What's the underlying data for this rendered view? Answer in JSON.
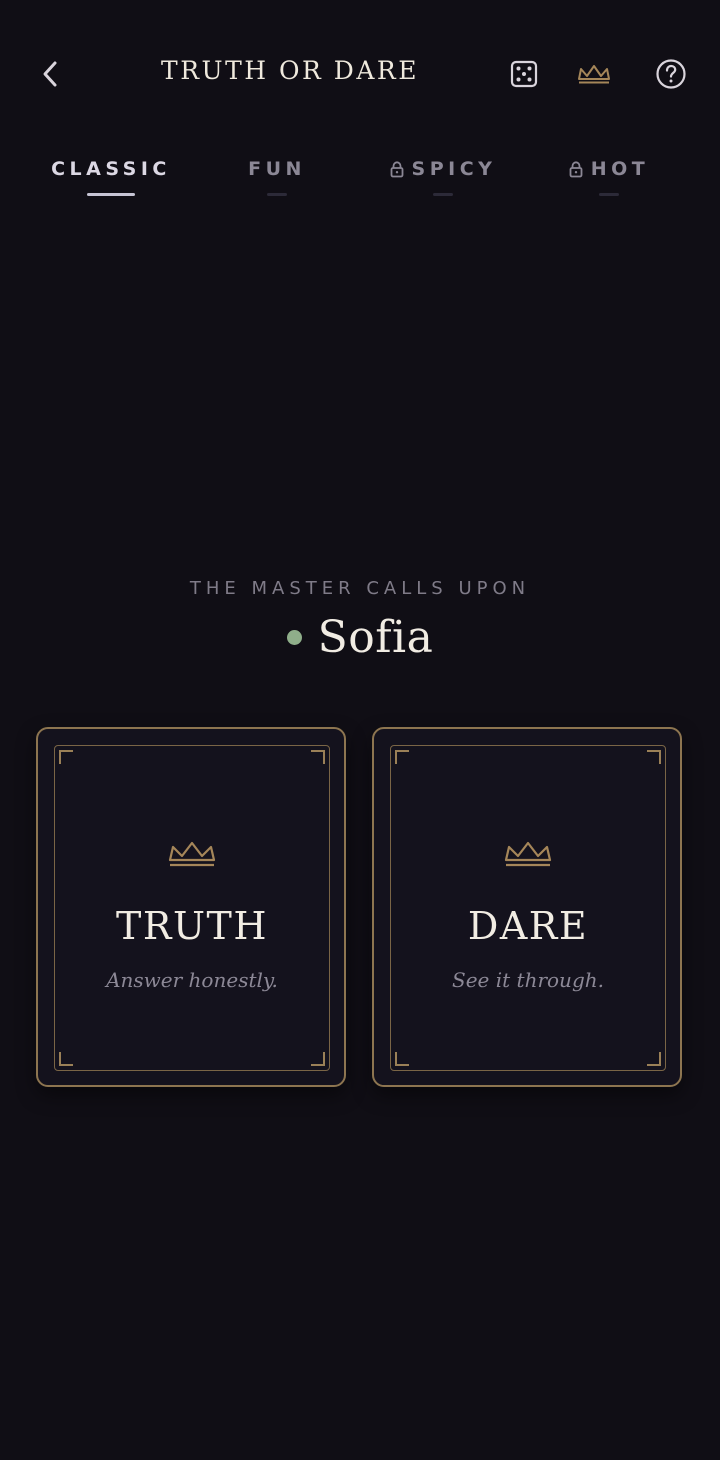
{
  "header": {
    "back_icon": "chevron-left-icon",
    "title": "TRUTH OR DARE",
    "icons": [
      "dice-icon",
      "crown-icon",
      "help-icon"
    ]
  },
  "tabs": [
    {
      "label": "CLASSIC",
      "locked": false,
      "active": true
    },
    {
      "label": "FUN",
      "locked": false,
      "active": false
    },
    {
      "label": "SPICY",
      "locked": true,
      "active": false
    },
    {
      "label": "HOT",
      "locked": true,
      "active": false
    }
  ],
  "turn": {
    "caption": "THE MASTER CALLS UPON",
    "player_name": "Sofia",
    "status_color": "#8fae8a"
  },
  "cards": [
    {
      "title": "TRUTH",
      "subtitle": "Answer honestly.",
      "icon": "crown-icon"
    },
    {
      "title": "DARE",
      "subtitle": "See it through.",
      "icon": "crown-icon"
    }
  ],
  "colors": {
    "background": "#100e15",
    "gold": "#8d7550",
    "active_tab": "#dcd8e4"
  }
}
